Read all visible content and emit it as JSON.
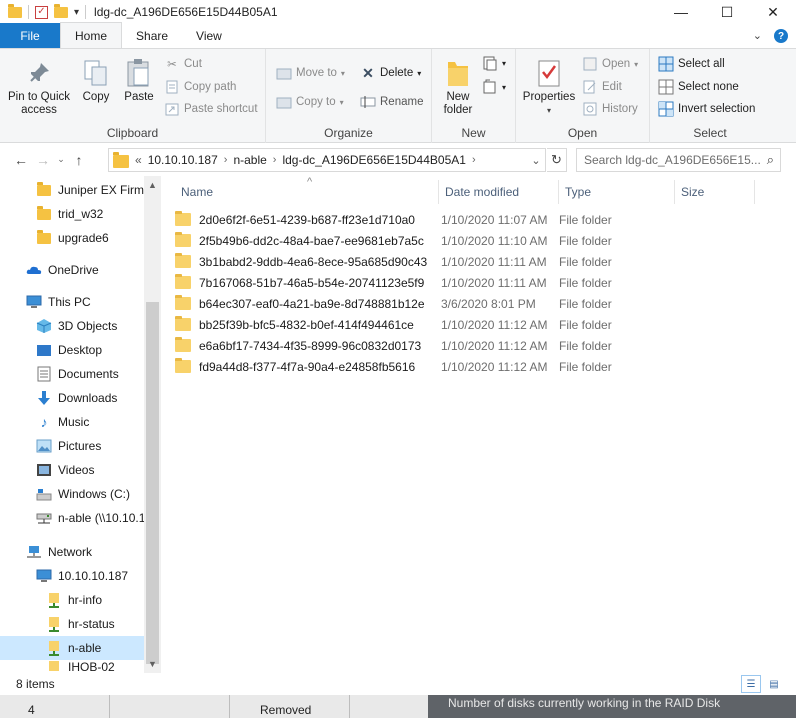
{
  "window": {
    "title": "ldg-dc_A196DE656E15D44B05A1",
    "minimize": "—",
    "maximize": "☐",
    "close": "✕"
  },
  "tabs": [
    {
      "label": "File"
    },
    {
      "label": "Home"
    },
    {
      "label": "Share"
    },
    {
      "label": "View"
    }
  ],
  "ribbon": {
    "clipboard": {
      "label": "Clipboard",
      "pin": "Pin to Quick access",
      "copy": "Copy",
      "paste": "Paste",
      "cut": "Cut",
      "copy_path": "Copy path",
      "paste_shortcut": "Paste shortcut"
    },
    "organize": {
      "label": "Organize",
      "move_to": "Move to",
      "copy_to": "Copy to",
      "delete": "Delete",
      "rename": "Rename"
    },
    "new": {
      "label": "New",
      "new_folder": "New folder"
    },
    "open": {
      "label": "Open",
      "properties": "Properties",
      "open": "Open",
      "edit": "Edit",
      "history": "History"
    },
    "select": {
      "label": "Select",
      "select_all": "Select all",
      "select_none": "Select none",
      "invert": "Invert selection"
    }
  },
  "address": {
    "prefix": "«",
    "crumbs": [
      "10.10.10.187",
      "n-able",
      "ldg-dc_A196DE656E15D44B05A1"
    ],
    "search_placeholder": "Search ldg-dc_A196DE656E15..."
  },
  "nav": {
    "items": [
      {
        "label": "Juniper EX Firmw",
        "icon": "folder-icon"
      },
      {
        "label": "trid_w32",
        "icon": "folder-icon"
      },
      {
        "label": "upgrade6",
        "icon": "folder-icon"
      },
      {
        "label": "OneDrive",
        "icon": "onedrive-icon"
      },
      {
        "label": "This PC",
        "icon": "pc-icon"
      },
      {
        "label": "3D Objects",
        "icon": "3d-objects-icon"
      },
      {
        "label": "Desktop",
        "icon": "desktop-icon"
      },
      {
        "label": "Documents",
        "icon": "documents-icon"
      },
      {
        "label": "Downloads",
        "icon": "downloads-icon"
      },
      {
        "label": "Music",
        "icon": "music-icon"
      },
      {
        "label": "Pictures",
        "icon": "pictures-icon"
      },
      {
        "label": "Videos",
        "icon": "videos-icon"
      },
      {
        "label": "Windows (C:)",
        "icon": "drive-icon"
      },
      {
        "label": "n-able (\\\\10.10.1",
        "icon": "network-drive-icon"
      },
      {
        "label": "Network",
        "icon": "network-icon"
      },
      {
        "label": "10.10.10.187",
        "icon": "computer-icon"
      },
      {
        "label": "hr-info",
        "icon": "share-folder-icon"
      },
      {
        "label": "hr-status",
        "icon": "share-folder-icon"
      },
      {
        "label": "n-able",
        "icon": "share-folder-icon"
      },
      {
        "label": "IHOB-02",
        "icon": "share-folder-icon"
      }
    ]
  },
  "columns": {
    "name": "Name",
    "date": "Date modified",
    "type": "Type",
    "size": "Size"
  },
  "files": [
    {
      "name": "2d0e6f2f-6e51-4239-b687-ff23e1d710a0",
      "date": "1/10/2020 11:07 AM",
      "type": "File folder"
    },
    {
      "name": "2f5b49b6-dd2c-48a4-bae7-ee9681eb7a5c",
      "date": "1/10/2020 11:10 AM",
      "type": "File folder"
    },
    {
      "name": "3b1babd2-9ddb-4ea6-8ece-95a685d90c43",
      "date": "1/10/2020 11:11 AM",
      "type": "File folder"
    },
    {
      "name": "7b167068-51b7-46a5-b54e-20741123e5f9",
      "date": "1/10/2020 11:11 AM",
      "type": "File folder"
    },
    {
      "name": "b64ec307-eaf0-4a21-ba9e-8d748881b12e",
      "date": "3/6/2020 8:01 PM",
      "type": "File folder"
    },
    {
      "name": "bb25f39b-bfc5-4832-b0ef-414f494461ce",
      "date": "1/10/2020 11:12 AM",
      "type": "File folder"
    },
    {
      "name": "e6a6bf17-7434-4f35-8999-96c0832d0173",
      "date": "1/10/2020 11:12 AM",
      "type": "File folder"
    },
    {
      "name": "fd9a44d8-f377-4f7a-90a4-e24858fb5616",
      "date": "1/10/2020 11:12 AM",
      "type": "File folder"
    }
  ],
  "status": {
    "count": "8 items"
  },
  "background_app": {
    "cell1": "4",
    "cell2": "Removed",
    "panel_text": "Number of disks currently working in the RAID Disk"
  }
}
